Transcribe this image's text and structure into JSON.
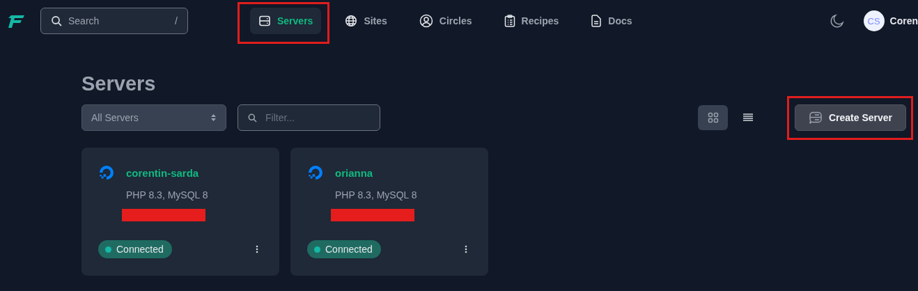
{
  "header": {
    "search": {
      "placeholder": "Search",
      "shortcut": "/"
    },
    "nav": [
      {
        "label": "Servers",
        "selected": true,
        "highlighted": true
      },
      {
        "label": "Sites",
        "selected": false,
        "highlighted": false
      },
      {
        "label": "Circles",
        "selected": false,
        "highlighted": false
      },
      {
        "label": "Recipes",
        "selected": false,
        "highlighted": false
      },
      {
        "label": "Docs",
        "selected": false,
        "highlighted": false
      }
    ],
    "user": {
      "initials": "CS",
      "name": "Coren"
    }
  },
  "page": {
    "title": "Servers",
    "filter_select": {
      "value": "All Servers"
    },
    "filter": {
      "placeholder": "Filter..."
    },
    "views": [
      {
        "kind": "grid",
        "selected": true
      },
      {
        "kind": "list",
        "selected": false
      }
    ],
    "create_button": {
      "label": "Create Server",
      "highlighted": true
    }
  },
  "servers": [
    {
      "name": "corentin-sarda",
      "stack": "PHP 8.3, MySQL 8",
      "redacted": true,
      "status": "Connected"
    },
    {
      "name": "orianna",
      "stack": "PHP 8.3, MySQL 8",
      "redacted": true,
      "status": "Connected"
    }
  ]
}
